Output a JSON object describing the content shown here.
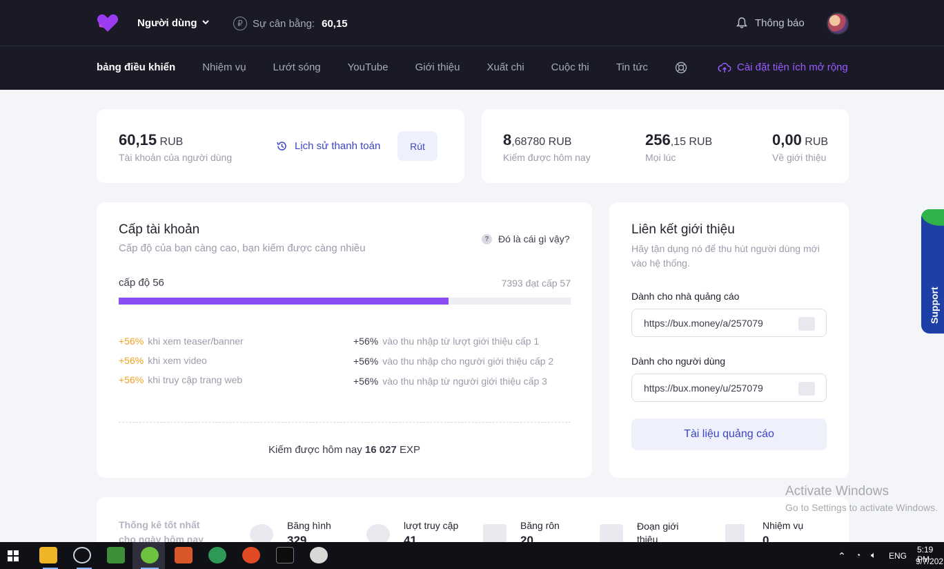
{
  "header": {
    "user_menu": "Người dùng",
    "balance_label": "Sự cân bằng:",
    "balance_value": "60,15",
    "notifications": "Thông báo"
  },
  "nav": {
    "items": [
      "bảng điều khiển",
      "Nhiệm vụ",
      "Lướt sóng",
      "YouTube",
      "Giới thiệu",
      "Xuất chi",
      "Cuộc thi",
      "Tin tức"
    ],
    "install_extension": "Cài đặt tiện ích mở rộng"
  },
  "account": {
    "amount": "60,15",
    "currency": "RUB",
    "label": "Tài khoản của người dùng",
    "history": "Lịch sử thanh toán",
    "withdraw": "Rút"
  },
  "earnings": {
    "today_int": "8",
    "today_frac": ",68780 RUB",
    "today_label": "Kiếm được hôm nay",
    "all_int": "256",
    "all_frac": ",15 RUB",
    "all_label": "Mọi lúc",
    "ref_int": "0,00",
    "ref_frac": "RUB",
    "ref_label": "Về giới thiệu"
  },
  "level": {
    "title": "Cấp tài khoản",
    "subtitle": "Cấp độ của bạn càng cao, bạn kiếm được càng nhiều",
    "what": "Đó là cái gì vậy?",
    "current": "cấp độ 56",
    "next": "7393 đạt cấp 57",
    "progress": 0.73,
    "bonuses_left": [
      {
        "pct": "+56%",
        "text": "khi xem teaser/banner"
      },
      {
        "pct": "+56%",
        "text": "khi xem video"
      },
      {
        "pct": "+56%",
        "text": "khi truy cập trang web"
      }
    ],
    "bonuses_right": [
      {
        "pct": "+56%",
        "text": "vào thu nhập từ lượt giới thiệu cấp 1"
      },
      {
        "pct": "+56%",
        "text": "vào thu nhập cho người giới thiệu cấp 2"
      },
      {
        "pct": "+56%",
        "text": "vào thu nhập từ người giới thiệu cấp 3"
      }
    ],
    "earned_prefix": "Kiếm được hôm nay",
    "earned_value": "16 027",
    "earned_unit": "EXP"
  },
  "referral": {
    "title": "Liên kết giới thiệu",
    "subtitle": "Hãy tận dụng nó để thu hút người dùng mới vào hệ thống.",
    "advertisers_label": "Dành cho nhà quảng cáo",
    "advertisers_url": "https://bux.money/a/257079",
    "users_label": "Dành cho người dùng",
    "users_url": "https://bux.money/u/257079",
    "materials": "Tài liệu quảng cáo"
  },
  "stats": {
    "title": "Thống kê tốt nhất cho ngày hôm nay",
    "items": [
      {
        "label": "Băng hình",
        "value": "329"
      },
      {
        "label": "lượt truy cập",
        "value": "41"
      },
      {
        "label": "Băng rôn",
        "value": "20"
      },
      {
        "label": "Đoạn giới thiệu",
        "value": ""
      },
      {
        "label": "Nhiệm vụ",
        "value": "0"
      }
    ]
  },
  "support": "Support",
  "watermark": {
    "line1": "Activate Windows",
    "line2": "Go to Settings to activate Windows."
  },
  "taskbar": {
    "lang": "ENG",
    "time": "5:19 PM",
    "date": "9/7/202"
  }
}
